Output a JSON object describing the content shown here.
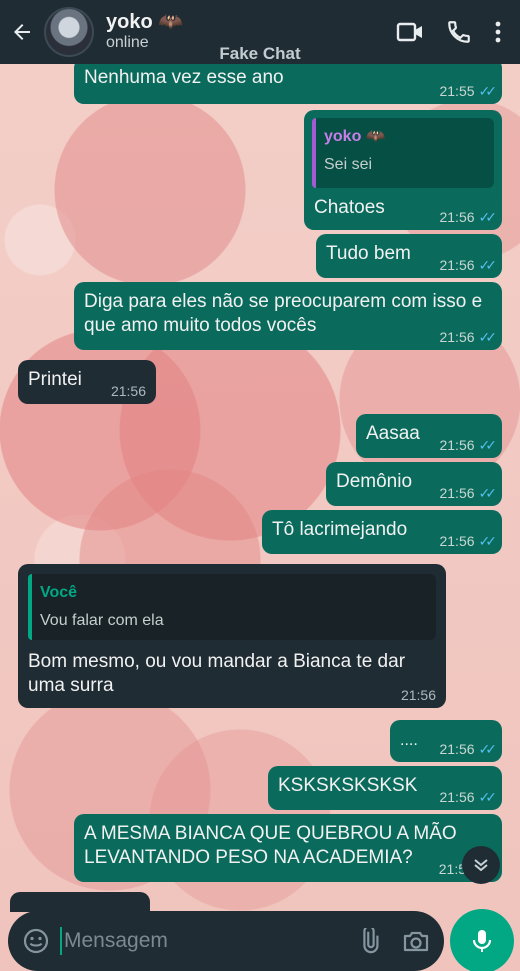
{
  "header": {
    "contact_name": "yoko 🦇",
    "status": "online",
    "app_label": "Fake Chat"
  },
  "messages": [
    {
      "dir": "out",
      "text": "Nenhuma vez esse ano",
      "time": "21:55"
    },
    {
      "dir": "out",
      "quote_name": "yoko 🦇",
      "quote_text": "Sei sei",
      "text": "Chatoes",
      "time": "21:56"
    },
    {
      "dir": "out",
      "text": "Tudo bem",
      "time": "21:56"
    },
    {
      "dir": "out",
      "text": "Diga para eles não se preocuparem com isso e que amo muito todos vocês",
      "time": "21:56"
    },
    {
      "dir": "in",
      "text": "Printei",
      "time": "21:56"
    },
    {
      "dir": "out",
      "text": "Aasaa",
      "time": "21:56"
    },
    {
      "dir": "out",
      "text": "Demônio",
      "time": "21:56"
    },
    {
      "dir": "out",
      "text": "Tô lacrimejando",
      "time": "21:56"
    },
    {
      "dir": "in",
      "quote_name": "Você",
      "quote_text": "Vou falar com ela",
      "text": "Bom mesmo, ou vou mandar a Bianca te dar uma surra",
      "time": "21:56"
    },
    {
      "dir": "out",
      "text": "....",
      "time": "21:56"
    },
    {
      "dir": "out",
      "text": "KSKSKSKSKSK",
      "time": "21:56"
    },
    {
      "dir": "out",
      "text": "A MESMA BIANCA QUE QUEBROU A MÃO LEVANTANDO PESO NA ACADEMIA?",
      "time": "21:5"
    }
  ],
  "input": {
    "placeholder": "Mensagem"
  },
  "colors": {
    "header_bg": "#1f2c33",
    "outgoing_bubble": "#0a6b5c",
    "incoming_bubble": "#1f2c33",
    "accent": "#02a884",
    "read_ticks": "#53bdeb"
  },
  "icons": [
    "back-arrow-icon",
    "video-call-icon",
    "phone-icon",
    "more-options-icon",
    "emoji-icon",
    "attach-icon",
    "camera-icon",
    "mic-icon",
    "scroll-down-icon",
    "double-check-icon"
  ]
}
